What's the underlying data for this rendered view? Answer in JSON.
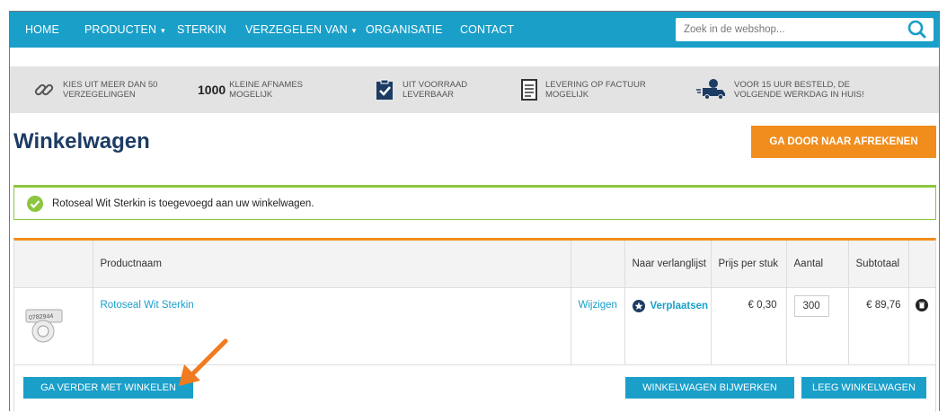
{
  "nav": {
    "items": [
      {
        "label": "HOME",
        "caret": false
      },
      {
        "label": "PRODUCTEN",
        "caret": true
      },
      {
        "label": "STERKIN",
        "caret": false
      },
      {
        "label": "VERZEGELEN VAN",
        "caret": true
      },
      {
        "label": "ORGANISATIE",
        "caret": false
      },
      {
        "label": "CONTACT",
        "caret": false
      }
    ],
    "search_placeholder": "Zoek in de webshop...",
    "search_icon": "search-icon"
  },
  "usp": [
    {
      "icon": "link-icon",
      "line1": "KIES UIT MEER DAN 50",
      "line2": "VERZEGELINGEN"
    },
    {
      "icon": "number",
      "number": "1000",
      "line1": "KLEINE AFNAMES",
      "line2": "MOGELIJK"
    },
    {
      "icon": "clipboard-check-icon",
      "line1": "UIT VOORRAAD",
      "line2": "LEVERBAAR"
    },
    {
      "icon": "invoice-icon",
      "line1": "LEVERING OP FACTUUR",
      "line2": "MOGELIJK"
    },
    {
      "icon": "delivery-truck-icon",
      "line1": "VOOR 15 UUR BESTELD, DE",
      "line2": "VOLGENDE WERKDAG IN HUIS!"
    }
  ],
  "page": {
    "title": "Winkelwagen",
    "checkout_label": "GA DOOR NAAR AFREKENEN"
  },
  "alert": {
    "message": "Rotoseal Wit Sterkin is toegevoegd aan uw winkelwagen."
  },
  "cart": {
    "headers": {
      "image": "",
      "product": "Productnaam",
      "edit": "",
      "wishlist": "Naar verlanglijst",
      "price": "Prijs per stuk",
      "qty": "Aantal",
      "subtotal": "Subtotaal",
      "remove": ""
    },
    "rows": [
      {
        "image_label": "0782944",
        "name": "Rotoseal Wit Sterkin",
        "edit": "Wijzigen",
        "move": "Verplaatsen",
        "price": "€ 0,30",
        "qty": "300",
        "subtotal": "€ 89,76"
      }
    ],
    "continue_label": "GA VERDER MET WINKELEN",
    "update_label": "WINKELWAGEN BIJWERKEN",
    "empty_label": "LEEG WINKELWAGEN"
  },
  "colors": {
    "nav": "#1a9fc9",
    "accent_orange": "#f18d1c",
    "success_green": "#8cc63f",
    "title_navy": "#1d3c64"
  }
}
